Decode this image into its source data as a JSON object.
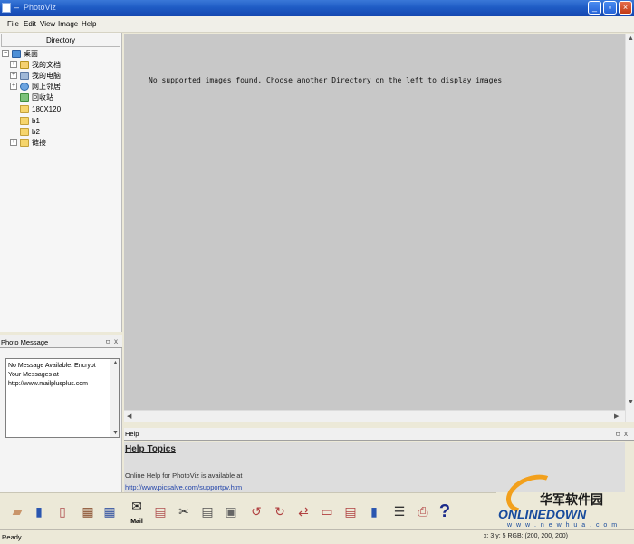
{
  "window": {
    "title": "PhotoViz",
    "sys_glyph": "–"
  },
  "menu": [
    "File",
    "Edit",
    "View",
    "Image",
    "Help"
  ],
  "directory": {
    "header": "Directory",
    "items": [
      {
        "label": "桌面",
        "icon": "desktop-icon",
        "expander": "−"
      },
      {
        "label": "我的文档",
        "icon": "documents-folder-icon",
        "expander": "+"
      },
      {
        "label": "我的电脑",
        "icon": "computer-icon",
        "expander": "+"
      },
      {
        "label": "网上邻居",
        "icon": "network-icon",
        "expander": "+"
      },
      {
        "label": "回收站",
        "icon": "recycle-bin-icon",
        "expander": ""
      },
      {
        "label": "180X120",
        "icon": "folder-icon",
        "expander": ""
      },
      {
        "label": "b1",
        "icon": "folder-icon",
        "expander": ""
      },
      {
        "label": "b2",
        "icon": "folder-icon",
        "expander": ""
      },
      {
        "label": "链接",
        "icon": "folder-icon",
        "expander": "+"
      }
    ]
  },
  "photo_message": {
    "title": "Photo Message",
    "pin": "ㅁ",
    "close": "x",
    "body": "No Message Available. Encrypt Your Messages at http://www.mailplusplus.com"
  },
  "viewer": {
    "message": "No supported images found. Choose another Directory on the left to display images."
  },
  "help": {
    "title": "Help",
    "pin": "ㅁ",
    "close": "x",
    "heading": "Help Topics",
    "line": "Online Help for PhotoViz is available at",
    "link": "http://www.picsalve.com/supportpv.htm"
  },
  "toolbar": {
    "mail_label": "Mail",
    "help_label": "?",
    "items": [
      {
        "name": "open-folder-icon",
        "glyph": "▰",
        "color": "#c9956a"
      },
      {
        "name": "export-icon",
        "glyph": "▮",
        "color": "#2a56b0"
      },
      {
        "name": "paperclip-icon",
        "glyph": "▯",
        "color": "#b05050"
      },
      {
        "name": "thumbnail-view-icon",
        "glyph": "▦",
        "color": "#8a5030"
      },
      {
        "name": "calendar-view-icon",
        "glyph": "▦",
        "color": "#3050a0"
      },
      {
        "name": "mail-icon",
        "glyph": "✉",
        "color": "#222"
      },
      {
        "name": "document-icon",
        "glyph": "▤",
        "color": "#b05050"
      },
      {
        "name": "cut-icon",
        "glyph": "✂",
        "color": "#333"
      },
      {
        "name": "copy-icon",
        "glyph": "▤",
        "color": "#555"
      },
      {
        "name": "paste-icon",
        "glyph": "▣",
        "color": "#666"
      },
      {
        "name": "rotate-left-icon",
        "glyph": "↺",
        "color": "#b04040"
      },
      {
        "name": "rotate-right-icon",
        "glyph": "↻",
        "color": "#b04040"
      },
      {
        "name": "flip-icon",
        "glyph": "⇄",
        "color": "#b04040"
      },
      {
        "name": "resize-icon",
        "glyph": "▭",
        "color": "#b04040"
      },
      {
        "name": "properties-icon",
        "glyph": "▤",
        "color": "#b04040"
      },
      {
        "name": "sd-card-icon",
        "glyph": "▮",
        "color": "#2a56b0"
      },
      {
        "name": "list-icon",
        "glyph": "☰",
        "color": "#333"
      },
      {
        "name": "print-icon",
        "glyph": "⎙",
        "color": "#b04040"
      },
      {
        "name": "help-icon",
        "glyph": "?",
        "color": "#1a2a8a"
      }
    ]
  },
  "watermark": {
    "chinese": "华军软件园",
    "brand": "ONLINEDOWN",
    "url": "w w w . n e w h u a . c o m"
  },
  "status": {
    "left": "Ready",
    "right": "x: 3 y: 5  RGB: (200, 200, 200)"
  }
}
